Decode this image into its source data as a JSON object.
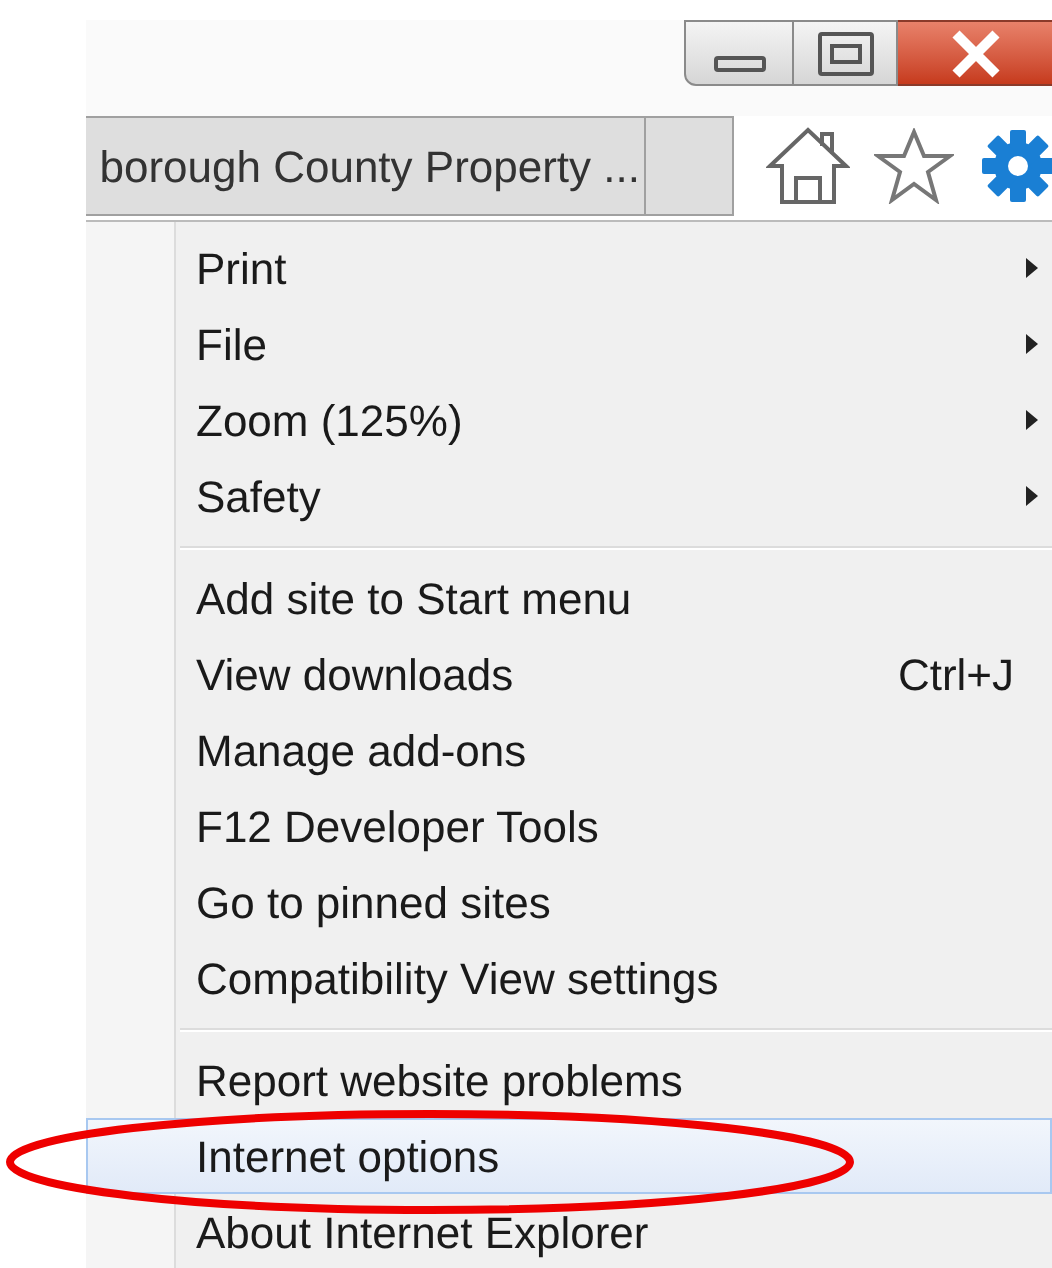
{
  "tab": {
    "title": "borough County Property ..."
  },
  "menu": {
    "groups": [
      {
        "items": [
          {
            "label": "Print",
            "submenu": true,
            "selected": false
          },
          {
            "label": "File",
            "submenu": true,
            "selected": false
          },
          {
            "label": "Zoom (125%)",
            "submenu": true,
            "selected": false
          },
          {
            "label": "Safety",
            "submenu": true,
            "selected": false
          }
        ]
      },
      {
        "items": [
          {
            "label": "Add site to Start menu",
            "submenu": false,
            "selected": false
          },
          {
            "label": "View downloads",
            "shortcut": "Ctrl+J",
            "submenu": false,
            "selected": false
          },
          {
            "label": "Manage add-ons",
            "submenu": false,
            "selected": false
          },
          {
            "label": "F12 Developer Tools",
            "submenu": false,
            "selected": false
          },
          {
            "label": "Go to pinned sites",
            "submenu": false,
            "selected": false
          },
          {
            "label": "Compatibility View settings",
            "submenu": false,
            "selected": false
          }
        ]
      },
      {
        "items": [
          {
            "label": "Report website problems",
            "submenu": false,
            "selected": false
          },
          {
            "label": "Internet options",
            "submenu": false,
            "selected": true
          },
          {
            "label": "About Internet Explorer",
            "submenu": false,
            "selected": false
          }
        ]
      }
    ]
  }
}
